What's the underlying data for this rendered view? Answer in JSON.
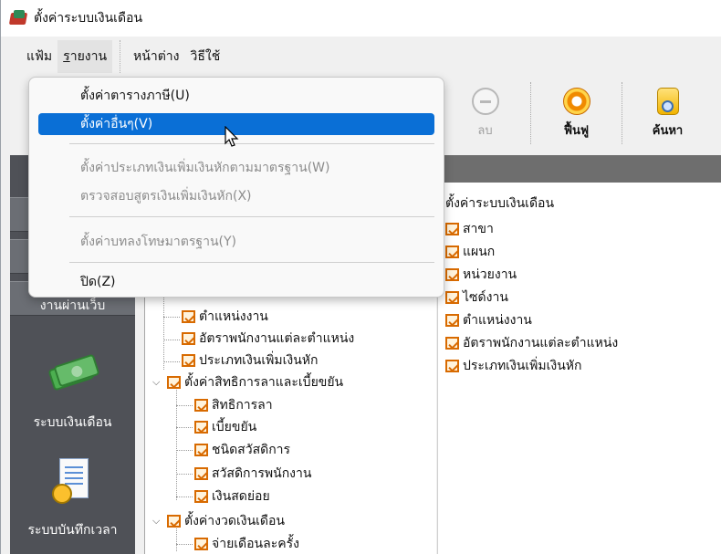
{
  "window": {
    "title": "ตั้งค่าระบบเงินเดือน"
  },
  "menubar": {
    "file": "แฟ้ม",
    "report_prefix": "",
    "report_underline": "ร",
    "report_rest": "ายงาน",
    "window": "หน้าต่าง",
    "help": "วิธีใช้"
  },
  "toolbar": {
    "delete": "ลบ",
    "restore": "ฟื้นฟู",
    "search": "ค้นหา"
  },
  "dropdown": {
    "items": [
      {
        "label": "ตั้งค่าตารางภาษี(U)",
        "state": "normal"
      },
      {
        "label": "ตั้งค่าอื่นๆ(V)",
        "state": "highlight"
      },
      {
        "label": "ตั้งค่าประเภทเงินเพิ่มเงินหักตามมาตรฐาน(W)",
        "state": "disabled"
      },
      {
        "label": "ตรวจสอบสูตรเงินเพิ่มเงินหัก(X)",
        "state": "disabled"
      },
      {
        "label": "ตั้งค่าบทลงโทษมาตรฐาน(Y)",
        "state": "disabled"
      },
      {
        "label": "ปิด(Z)",
        "state": "normal"
      }
    ]
  },
  "nav": {
    "web_item_partial": "งานผ่านเว็บ",
    "payroll": "ระบบเงินเดือน",
    "timekeeping": "ระบบบันทึกเวลา"
  },
  "tree": {
    "items": [
      "ตำแหน่งงาน",
      "อัตราพนักงานแต่ละตำแหน่ง",
      "ประเภทเงินเพิ่มเงินหัก",
      "ตั้งค่าสิทธิการลาและเบี้ยขยัน",
      "สิทธิการลา",
      "เบี้ยขยัน",
      "ชนิดสวัสดิการ",
      "สวัสดิการพนักงาน",
      "เงินสดย่อย",
      "ตั้งค่างวดเงินเดือน",
      "จ่ายเดือนละครั้ง"
    ]
  },
  "list": {
    "header": "ตั้งค่าระบบเงินเดือน",
    "items": [
      "สาขา",
      "แผนก",
      "หน่วยงาน",
      "ไซด์งาน",
      "ตำแหน่งงาน",
      "อัตราพนักงานแต่ละตำแหน่ง",
      "ประเภทเงินเพิ่มเงินหัก"
    ]
  }
}
